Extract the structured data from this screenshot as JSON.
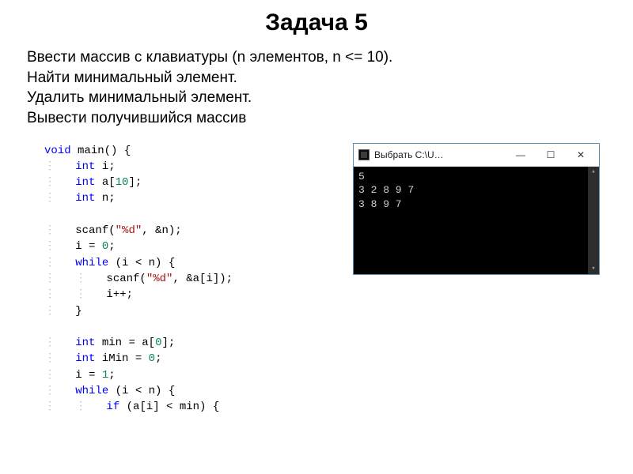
{
  "title": "Задача 5",
  "task": {
    "line1": "Ввести массив с клавиатуры (n элементов, n <= 10).",
    "line2": "Найти минимальный элемент.",
    "line3": "Удалить минимальный элемент.",
    "line4": "Вывести получившийся массив"
  },
  "code": {
    "l01a": "void",
    "l01b": " main() {",
    "l02a": "int",
    "l02b": " i;",
    "l03a": "int",
    "l03b": " a[",
    "l03c": "10",
    "l03d": "];",
    "l04a": "int",
    "l04b": " n;",
    "l05": "",
    "l06a": "scanf(",
    "l06b": "\"%d\"",
    "l06c": ", &n);",
    "l07a": "i = ",
    "l07b": "0",
    "l07c": ";",
    "l08a": "while",
    "l08b": " (i < n) {",
    "l09a": "scanf(",
    "l09b": "\"%d\"",
    "l09c": ", &a[i]);",
    "l10": "i++;",
    "l11": "}",
    "l12": "",
    "l13a": "int",
    "l13b": " min = a[",
    "l13c": "0",
    "l13d": "];",
    "l14a": "int",
    "l14b": " iMin = ",
    "l14c": "0",
    "l14d": ";",
    "l15a": "i = ",
    "l15b": "1",
    "l15c": ";",
    "l16a": "while",
    "l16b": " (i < n) {",
    "l17a": "if",
    "l17b": " (a[i] < min) {"
  },
  "console": {
    "title": "Выбрать C:\\U…",
    "out1": "5",
    "out2": "3 2 8 9 7",
    "out3": "3 8 9 7"
  },
  "win_buttons": {
    "min": "—",
    "max": "☐",
    "close": "✕"
  }
}
